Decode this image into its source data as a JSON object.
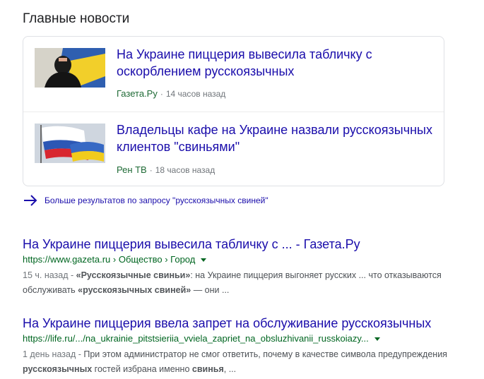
{
  "top_stories": {
    "heading": "Главные новости",
    "items": [
      {
        "title": "На Украине пиццерия вывесила табличку с оскорблением русскоязычных",
        "source": "Газета.Ру",
        "time": "14 часов назад",
        "image_alt": "man in black mask with Ukrainian flag"
      },
      {
        "title": "Владельцы кафе на Украине назвали русскоязычных клиентов \"свиньями\"",
        "source": "Рен ТВ",
        "time": "18 часов назад",
        "image_alt": "Russian and Ukrainian flags"
      }
    ],
    "separator": "·"
  },
  "more_results": {
    "label": "Больше результатов по запросу \"русскоязычных свиней\""
  },
  "results": [
    {
      "title": "На Украине пиццерия вывесила табличку с ... - Газета.Ру",
      "url": "https://www.gazeta.ru › Общество › Город",
      "date": "15 ч. назад - ",
      "snippet_parts": [
        {
          "t": "«Русскоязычные свиньи»",
          "b": true
        },
        {
          "t": ": на Украине пиццерия выгоняет русских ... что отказываются обслуживать ",
          "b": false
        },
        {
          "t": "«русскоязычных свиней»",
          "b": true
        },
        {
          "t": " — они ...",
          "b": false
        }
      ]
    },
    {
      "title": "На Украине пиццерия ввела запрет на обслуживание русскоязычных",
      "url": "https://life.ru/.../na_ukrainie_pitstsieriia_vviela_zapriet_na_obsluzhivanii_russkoiazy...",
      "date": "1 день назад - ",
      "snippet_parts": [
        {
          "t": "При этом администратор не смог ответить, почему в качестве символа предупреждения ",
          "b": false
        },
        {
          "t": "русскоязычных",
          "b": true
        },
        {
          "t": " гостей избрана именно ",
          "b": false
        },
        {
          "t": "свинья",
          "b": true
        },
        {
          "t": ", ...",
          "b": false
        }
      ]
    }
  ],
  "colors": {
    "link": "#1a0dab",
    "url_green": "#006621",
    "source_green": "#1e6a35",
    "meta_gray": "#70757a",
    "card_border": "#dfe1e5"
  }
}
